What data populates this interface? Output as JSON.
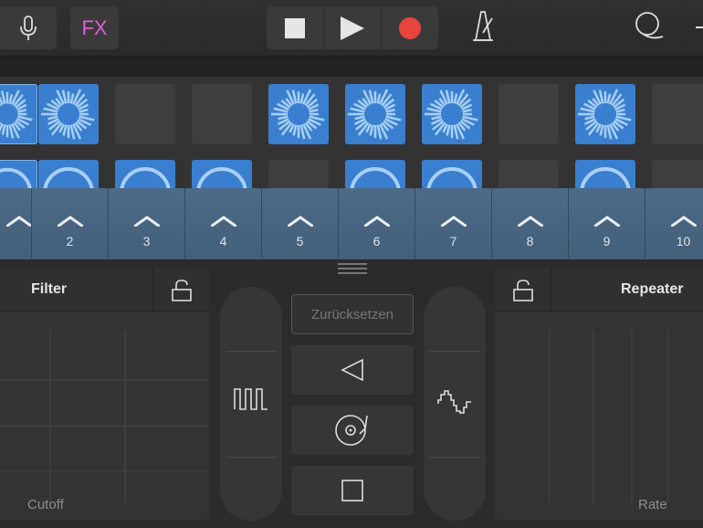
{
  "toolbar": {
    "fx_label": "FX",
    "icons": [
      "microphone-icon",
      "stop-icon",
      "play-icon",
      "record-icon",
      "metronome-icon",
      "loop-icon"
    ],
    "record_color": "#e8433d",
    "fx_color": "#e45dd8"
  },
  "grid": {
    "active_color": "#3a7fcf",
    "row1_active": [
      true,
      true,
      false,
      false,
      true,
      true,
      true,
      false,
      true,
      false
    ],
    "row2_active": [
      true,
      true,
      true,
      true,
      false,
      true,
      true,
      false,
      true,
      false
    ]
  },
  "triggers": {
    "numbers": [
      "2",
      "3",
      "4",
      "5",
      "6",
      "7",
      "8",
      "9",
      "10"
    ]
  },
  "filter": {
    "title": "Filter",
    "axis_label": "Cutoff"
  },
  "repeater": {
    "title": "Repeater",
    "axis_label": "Rate"
  },
  "controls": {
    "reset_label": "Zurücksetzen"
  }
}
